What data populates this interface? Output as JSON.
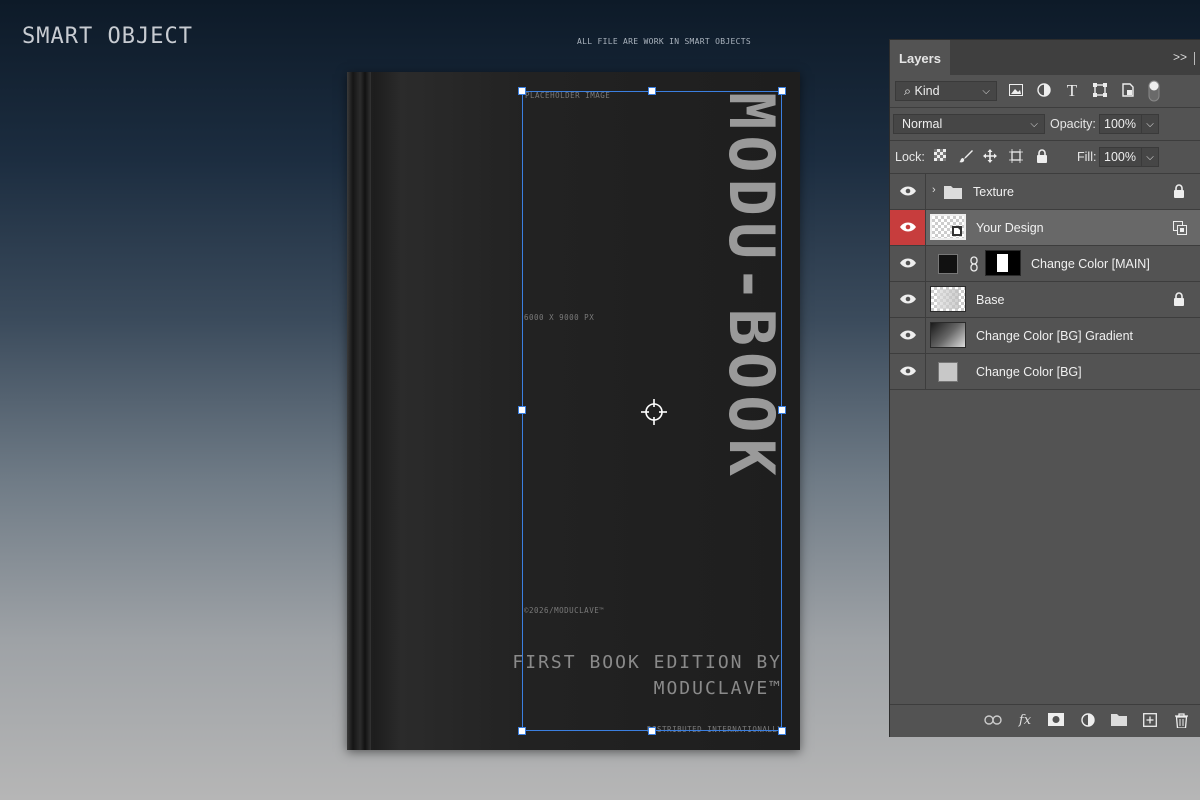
{
  "canvas": {
    "heading": "SMART OBJECT",
    "note": "ALL FILE ARE WORK IN SMART OBJECTS"
  },
  "book": {
    "vertical_title": "MODU-BOOK",
    "placeholder_label": "PLACEHOLDER IMAGE",
    "size_label": "6000 X 9000 PX",
    "copyright": "©2026/MODUCLAVE™",
    "edition_line1": "FIRST BOOK EDITION BY",
    "edition_line2": "MODUCLAVE™",
    "distributed": "DISTRIBUTED INTERNATIONALLY"
  },
  "layers_panel": {
    "tab_label": "Layers",
    "collapse_label": ">>",
    "filter": {
      "value": "Kind"
    },
    "blend_mode": "Normal",
    "opacity_label": "Opacity:",
    "opacity_value": "100%",
    "lock_label": "Lock:",
    "fill_label": "Fill:",
    "fill_value": "100%",
    "layers": [
      {
        "name": "Texture",
        "type": "group",
        "locked": true
      },
      {
        "name": "Your Design",
        "type": "smart-object",
        "selected": true
      },
      {
        "name": "Change Color [MAIN]",
        "type": "fill-with-mask"
      },
      {
        "name": "Base",
        "type": "pixel",
        "locked": true
      },
      {
        "name": "Change Color [BG] Gradient",
        "type": "gradient"
      },
      {
        "name": "Change Color [BG]",
        "type": "solid"
      }
    ]
  },
  "colors": {
    "selection": "#3b7fe0",
    "selected_eye_bg": "#c73d3d",
    "panel_bg": "#535353"
  }
}
